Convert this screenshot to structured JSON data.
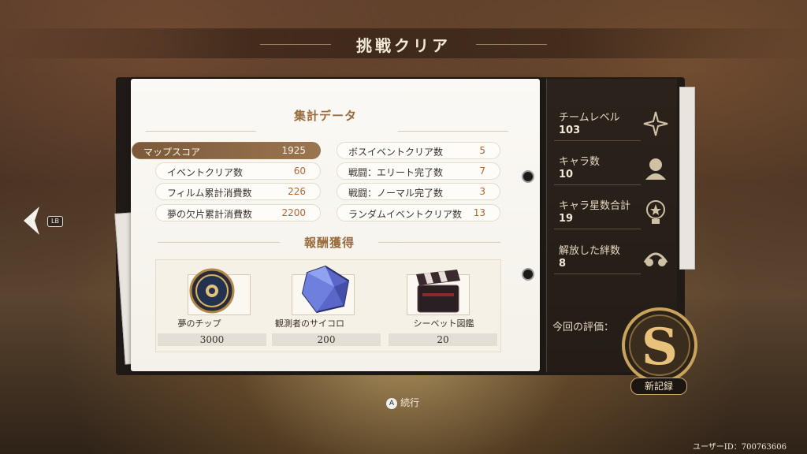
{
  "title": "挑戦クリア",
  "nav": {
    "back_button_badge": "LB"
  },
  "stats_section": {
    "title": "集計データ",
    "subtitle": "",
    "left": [
      {
        "label": "マップスコア",
        "value": "1925",
        "active": true
      },
      {
        "label": "イベントクリア数",
        "value": "60"
      },
      {
        "label": "フィルム累計消費数",
        "value": "226"
      },
      {
        "label": "夢の欠片累計消費数",
        "value": "2200"
      }
    ],
    "right": [
      {
        "label": "ボスイベントクリア数",
        "value": "5"
      },
      {
        "label": "戦闘：エリート完了数",
        "value": "7"
      },
      {
        "label": "戦闘：ノーマル完了数",
        "value": "3"
      },
      {
        "label": "ランダムイベントクリア数",
        "value": "13"
      }
    ]
  },
  "rewards_section": {
    "title": "報酬獲得",
    "items": [
      {
        "name": "夢のチップ",
        "qty": "3000",
        "icon": "chip-icon"
      },
      {
        "name": "観測者のサイコロ",
        "qty": "200",
        "icon": "dice-icon"
      },
      {
        "name": "シーベット図鑑",
        "qty": "20",
        "icon": "clapperboard-icon"
      }
    ]
  },
  "side_panel": {
    "items": [
      {
        "label": "チームレベル",
        "value": "103",
        "icon": "sparkle-icon"
      },
      {
        "label": "キャラ数",
        "value": "10",
        "icon": "character-icon"
      },
      {
        "label": "キャラ星数合計",
        "value": "19",
        "icon": "star-bulb-icon"
      },
      {
        "label": "解放した絆数",
        "value": "8",
        "icon": "bond-icon"
      }
    ],
    "evaluation_label": "今回の評価：",
    "grade": "S",
    "new_record": "新記録"
  },
  "footer": {
    "continue_button": "A",
    "continue_label": "続行",
    "user_id": "ユーザーID：700763606"
  },
  "colors": {
    "accent": "#b5652c",
    "highlight": "#9b7550",
    "panel_dark": "#241d17"
  }
}
